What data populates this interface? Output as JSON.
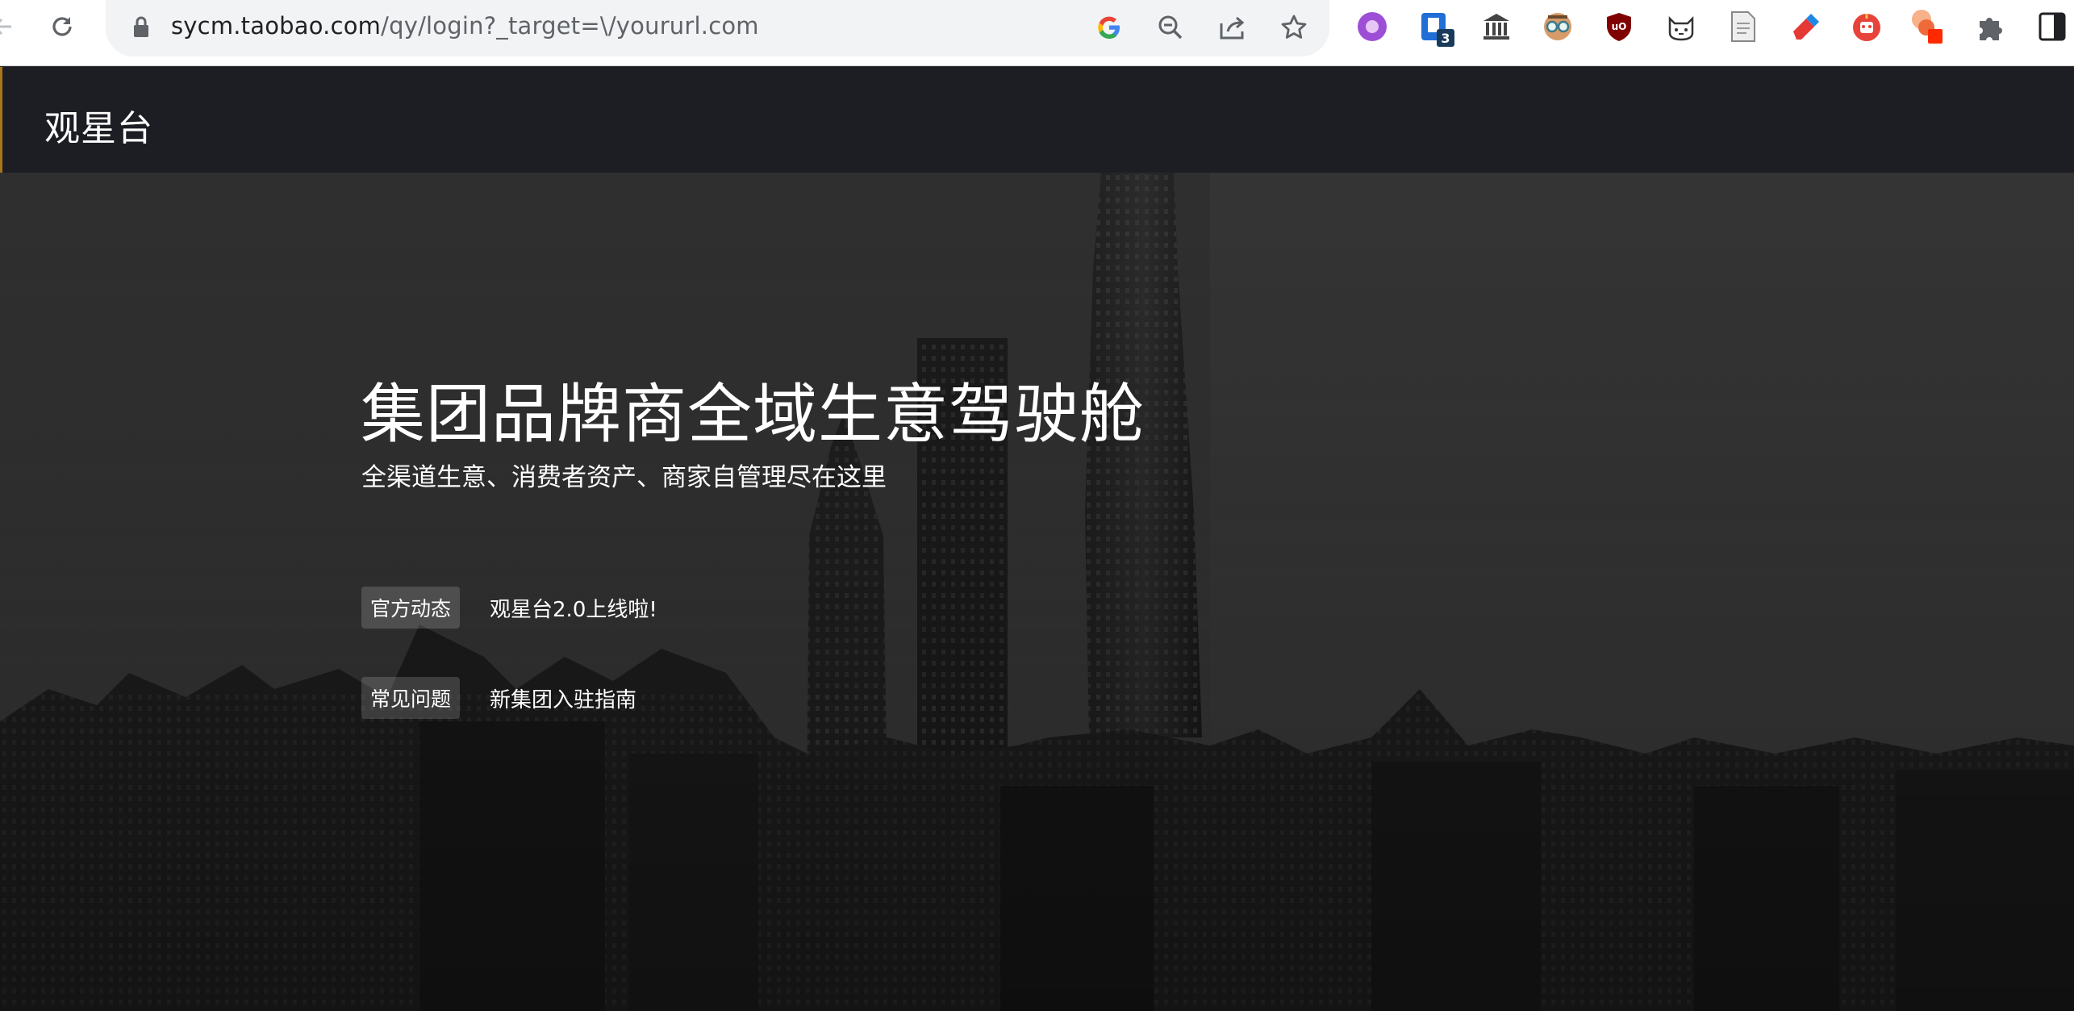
{
  "browser": {
    "url_host": "sycm.taobao.com",
    "url_path": "/qy/login?_target=\\/yoururl.com",
    "extensions": [
      {
        "name": "circle-extension-icon"
      },
      {
        "name": "bookmark-extension-icon",
        "badge": "3"
      },
      {
        "name": "library-extension-icon"
      },
      {
        "name": "glasses-extension-icon"
      },
      {
        "name": "ublock-extension-icon",
        "label": "uO"
      },
      {
        "name": "cat-extension-icon"
      },
      {
        "name": "document-extension-icon"
      },
      {
        "name": "eraser-extension-icon"
      },
      {
        "name": "robot-extension-icon"
      },
      {
        "name": "shapes-extension-icon"
      },
      {
        "name": "puzzle-extensions-icon"
      },
      {
        "name": "sidepanel-icon"
      }
    ]
  },
  "header": {
    "logo": "观星台"
  },
  "hero": {
    "title": "集团品牌商全域生意驾驶舱",
    "subtitle": "全渠道生意、消费者资产、商家自管理尽在这里",
    "news": [
      {
        "tag": "官方动态",
        "link": "观星台2.0上线啦!"
      },
      {
        "tag": "常见问题",
        "link": "新集团入驻指南"
      }
    ]
  },
  "colors": {
    "header_bg": "#1d1e24",
    "header_accent": "#a8761a",
    "hero_bg": "#333333",
    "text": "#ffffff"
  }
}
